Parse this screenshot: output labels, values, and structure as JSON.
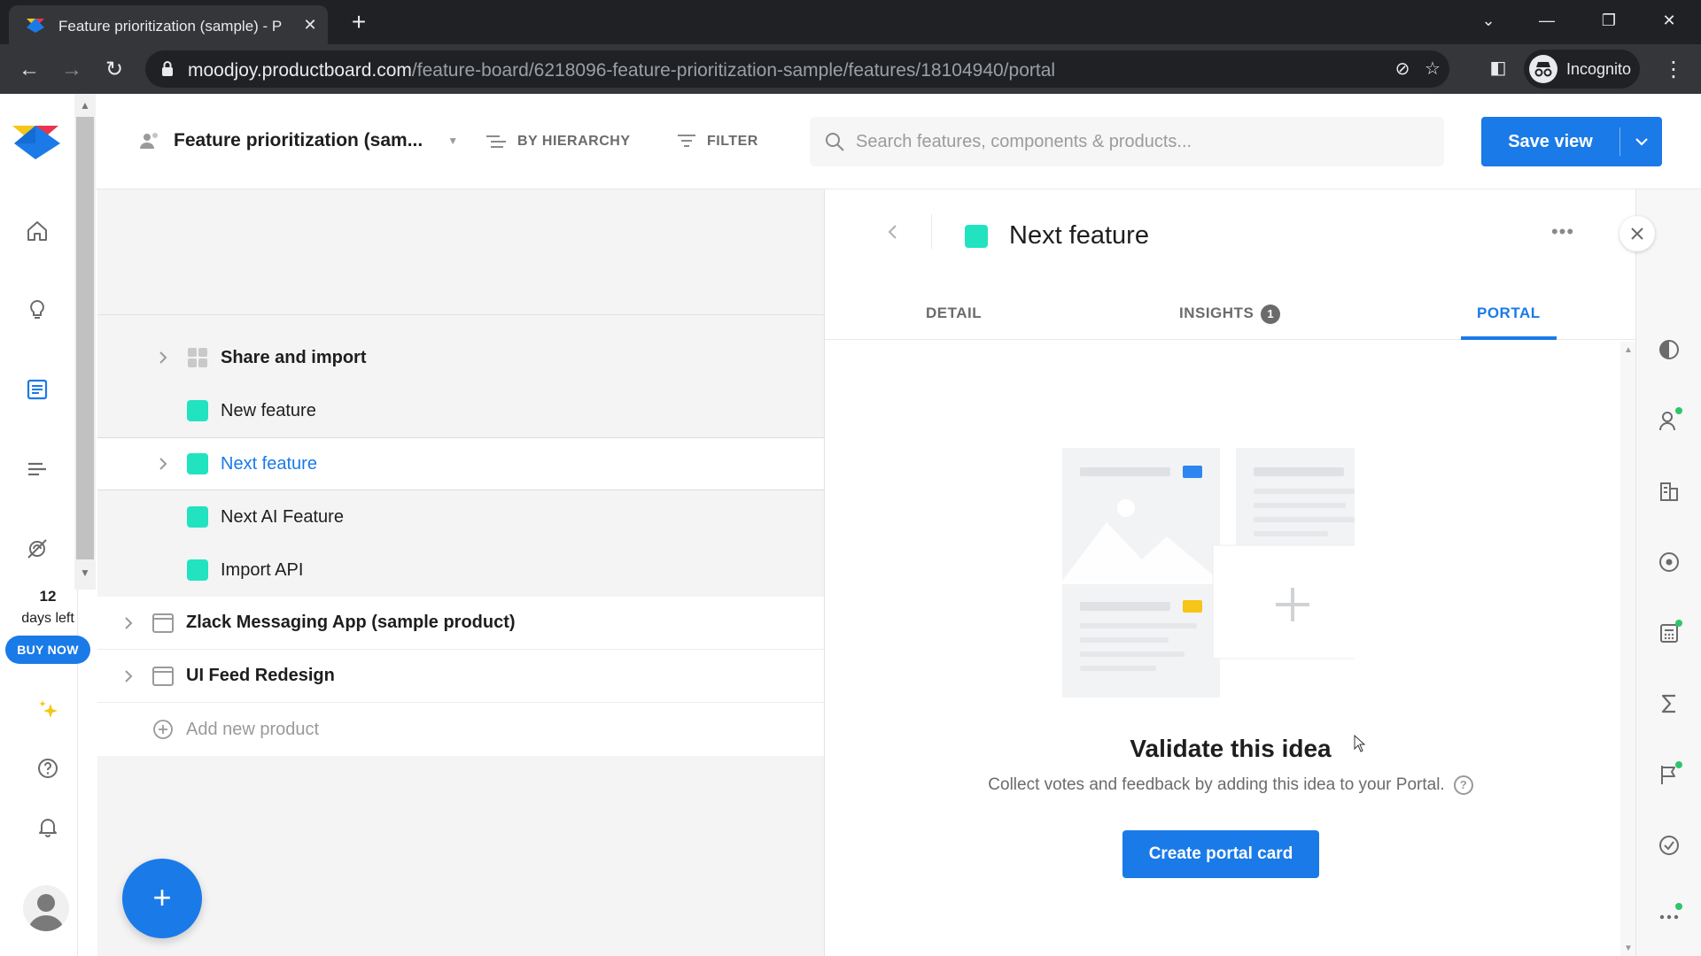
{
  "browser": {
    "tab_title": "Feature prioritization (sample) - P",
    "url_host": "moodjoy.productboard.com",
    "url_path": "/feature-board/6218096-feature-prioritization-sample/features/18104940/portal",
    "profile_label": "Incognito"
  },
  "sidebar": {
    "trial_days": "12",
    "trial_label": "days left",
    "buy_now": "BUY NOW"
  },
  "header": {
    "board_title": "Feature prioritization (sam...",
    "hierarchy_label": "BY HIERARCHY",
    "filter_label": "FILTER",
    "search_placeholder": "Search features, components & products...",
    "save_view": "Save view"
  },
  "tree": {
    "items": [
      {
        "label": "Share and import",
        "kind": "component"
      },
      {
        "label": "New feature",
        "kind": "feature"
      },
      {
        "label": "Next feature",
        "kind": "feature",
        "selected": true
      },
      {
        "label": "Next AI Feature",
        "kind": "feature"
      },
      {
        "label": "Import API",
        "kind": "feature"
      },
      {
        "label": "Zlack Messaging App (sample product)",
        "kind": "product"
      },
      {
        "label": "UI Feed Redesign",
        "kind": "product"
      }
    ],
    "add_product": "Add new product"
  },
  "detail": {
    "title": "Next feature",
    "tabs": [
      {
        "label": "DETAIL"
      },
      {
        "label": "INSIGHTS",
        "badge": "1"
      },
      {
        "label": "PORTAL",
        "active": true
      }
    ],
    "empty_title": "Validate this idea",
    "empty_subtitle": "Collect votes and feedback by adding this idea to your Portal.",
    "create_button": "Create portal card"
  },
  "colors": {
    "accent": "#1a7ae8",
    "feature_square": "#22e3bf",
    "selected_text": "#1a7ae8"
  }
}
